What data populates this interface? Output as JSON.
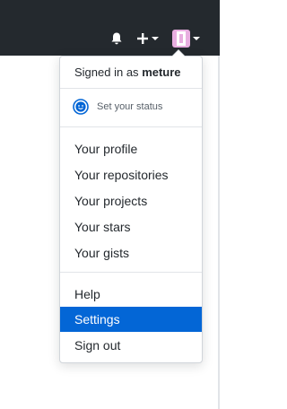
{
  "header": {
    "icons": {
      "notifications": "bell-icon",
      "create": "plus-icon",
      "create_dropdown": "caret-down-icon",
      "avatar": "avatar",
      "avatar_dropdown": "caret-down-icon"
    }
  },
  "menu": {
    "signed_in_prefix": "Signed in as",
    "username": "meture",
    "status_label": "Set your status",
    "status_icon": "smiley-icon",
    "items": [
      {
        "label": "Your profile"
      },
      {
        "label": "Your repositories"
      },
      {
        "label": "Your projects"
      },
      {
        "label": "Your stars"
      },
      {
        "label": "Your gists"
      }
    ],
    "bottom_items": [
      {
        "label": "Help"
      },
      {
        "label": "Settings",
        "active": true
      },
      {
        "label": "Sign out"
      }
    ]
  },
  "colors": {
    "header_bg": "#24292e",
    "active_bg": "#0366d6",
    "avatar": "#e8aee0"
  }
}
